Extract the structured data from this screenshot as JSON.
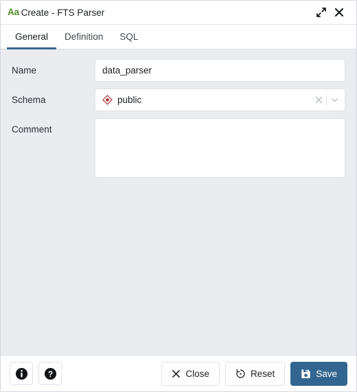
{
  "window": {
    "icon_label": "Aa",
    "icon_name": "fts-parser-icon",
    "icon_color": "#4e8b26",
    "title": "Create - FTS Parser",
    "controls": [
      {
        "name": "maximize-button",
        "label": "Maximize"
      },
      {
        "name": "close-button",
        "label": "Close"
      }
    ]
  },
  "tabs": [
    {
      "label": "General",
      "active": true
    },
    {
      "label": "Definition",
      "active": false
    },
    {
      "label": "SQL",
      "active": false
    }
  ],
  "accent_color": "#326690",
  "form": {
    "name": {
      "label": "Name",
      "value": "data_parser",
      "placeholder": ""
    },
    "schema": {
      "label": "Schema",
      "value": "public",
      "icon_name": "schema-diamond-icon",
      "icon_color": "#a63232",
      "clear_label": "Clear",
      "dropdown_label": "Open dropdown"
    },
    "comment": {
      "label": "Comment",
      "value": "",
      "placeholder": ""
    }
  },
  "footer": {
    "info_label": "Info",
    "help_label": "Help",
    "close_label": "Close",
    "reset_label": "Reset",
    "save_label": "Save"
  }
}
